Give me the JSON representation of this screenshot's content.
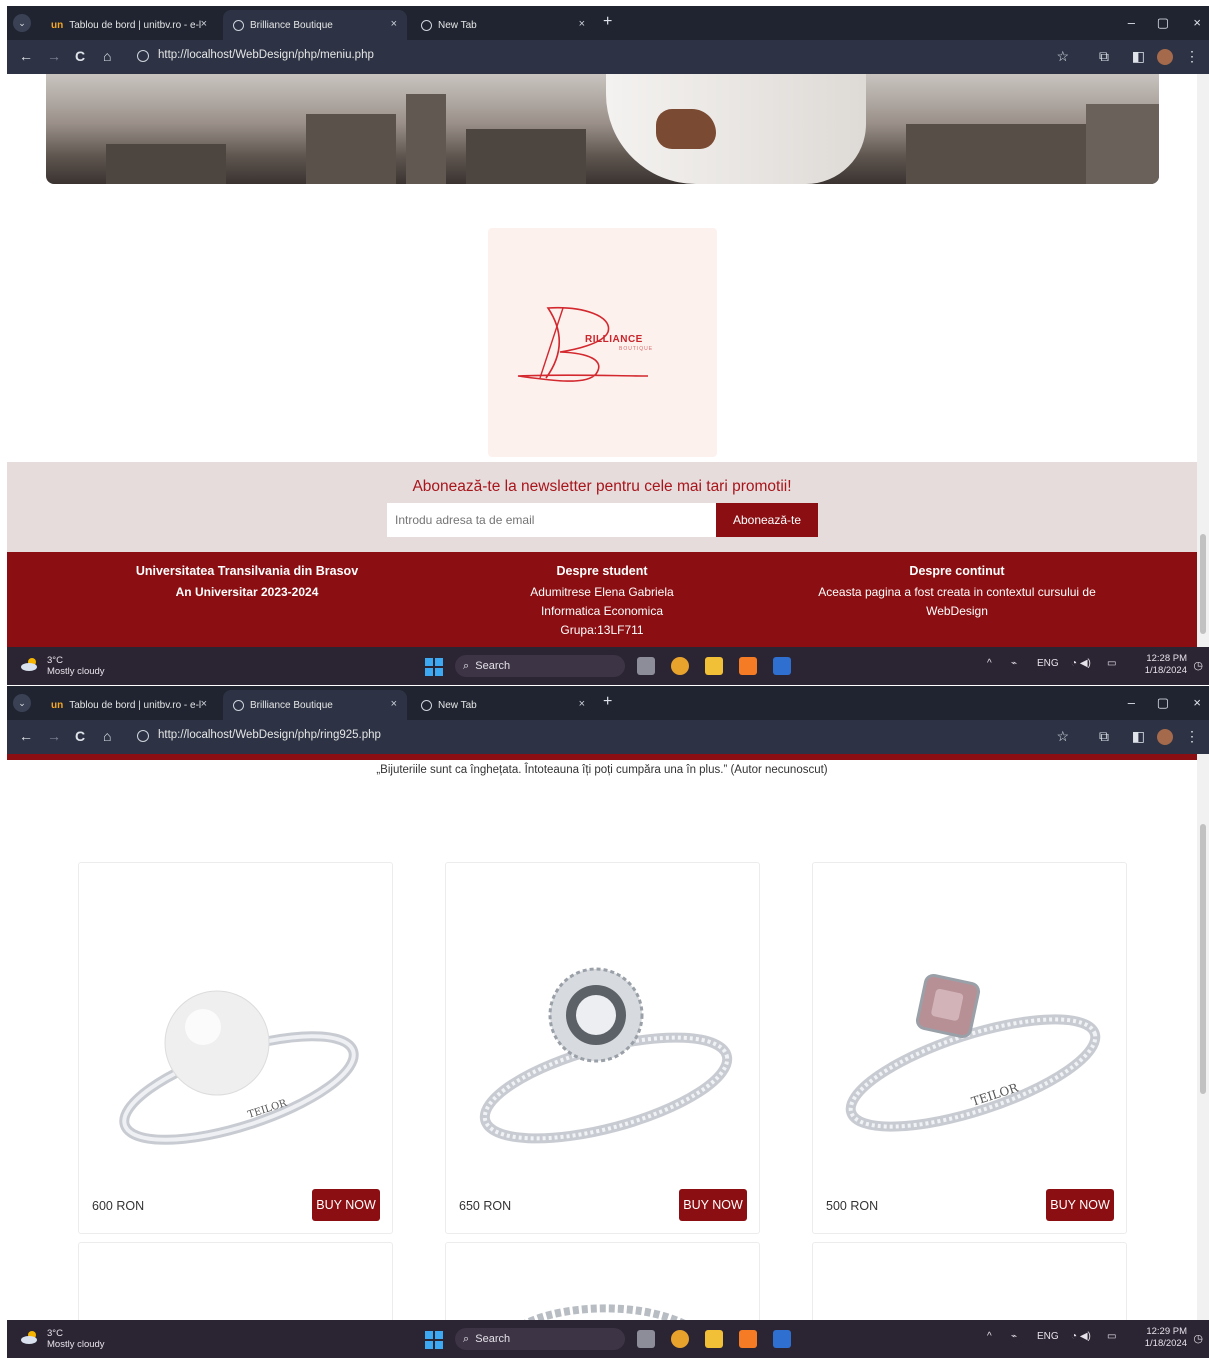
{
  "screen1": {
    "tabs": [
      {
        "label": "Tablou de bord | unitbv.ro - e-l"
      },
      {
        "label": "Brilliance Boutique"
      },
      {
        "label": "New Tab"
      }
    ],
    "url": "http://localhost/WebDesign/php/meniu.php",
    "logo": {
      "brand": "RILLIANCE",
      "sub": "BOUTIQUE",
      "initial": "B"
    },
    "newsletter": {
      "title": "Abonează-te la newsletter pentru cele mai tari promotii!",
      "placeholder": "Introdu adresa ta de email",
      "button": "Abonează-te"
    },
    "footer": [
      {
        "heading": "Universitatea Transilvania din Brasov",
        "lines": [
          "An Universitar 2023-2024"
        ]
      },
      {
        "heading": "Despre student",
        "lines": [
          "Adumitrese Elena Gabriela",
          "Informatica Economica",
          "Grupa:13LF711"
        ]
      },
      {
        "heading": "Despre continut",
        "lines": [
          "Aceasta pagina a fost creata in contextul cursului de",
          "WebDesign"
        ]
      }
    ],
    "taskbar": {
      "temp": "3°C",
      "weather": "Mostly cloudy",
      "search": "Search",
      "lang": "ENG",
      "time": "12:28 PM",
      "date": "1/18/2024"
    }
  },
  "screen2": {
    "tabs": [
      {
        "label": "Tablou de bord | unitbv.ro - e-l"
      },
      {
        "label": "Brilliance Boutique"
      },
      {
        "label": "New Tab"
      }
    ],
    "url": "http://localhost/WebDesign/php/ring925.php",
    "quote": "„Bijuteriile sunt ca înghețata. Întoteauna îți poți cumpăra una în plus.” (Autor necunoscut)",
    "products": [
      {
        "price": "600 RON",
        "button": "BUY NOW",
        "engraving": "TEILOR",
        "stone": "pearl"
      },
      {
        "price": "650 RON",
        "button": "BUY NOW",
        "engraving": "",
        "stone": "halo-diamond"
      },
      {
        "price": "500 RON",
        "button": "BUY NOW",
        "engraving": "TEILOR",
        "stone": "pink-gem"
      }
    ],
    "taskbar": {
      "temp": "3°C",
      "weather": "Mostly cloudy",
      "search": "Search",
      "lang": "ENG",
      "time": "12:29 PM",
      "date": "1/18/2024"
    }
  },
  "icons": {
    "back": "←",
    "forward": "→",
    "reload": "C",
    "home": "⌂",
    "star": "☆",
    "plus": "+",
    "close": "×",
    "minimize": "–",
    "restore": "▢",
    "menu": "⋮",
    "chevron": "⌄",
    "search": "⌕",
    "bell": "◷"
  },
  "colors": {
    "brand_red": "#8b0f12",
    "title_red": "#a8151b",
    "newsletter_bg": "#e6dcdc",
    "logo_bg": "#fdf1ee"
  }
}
